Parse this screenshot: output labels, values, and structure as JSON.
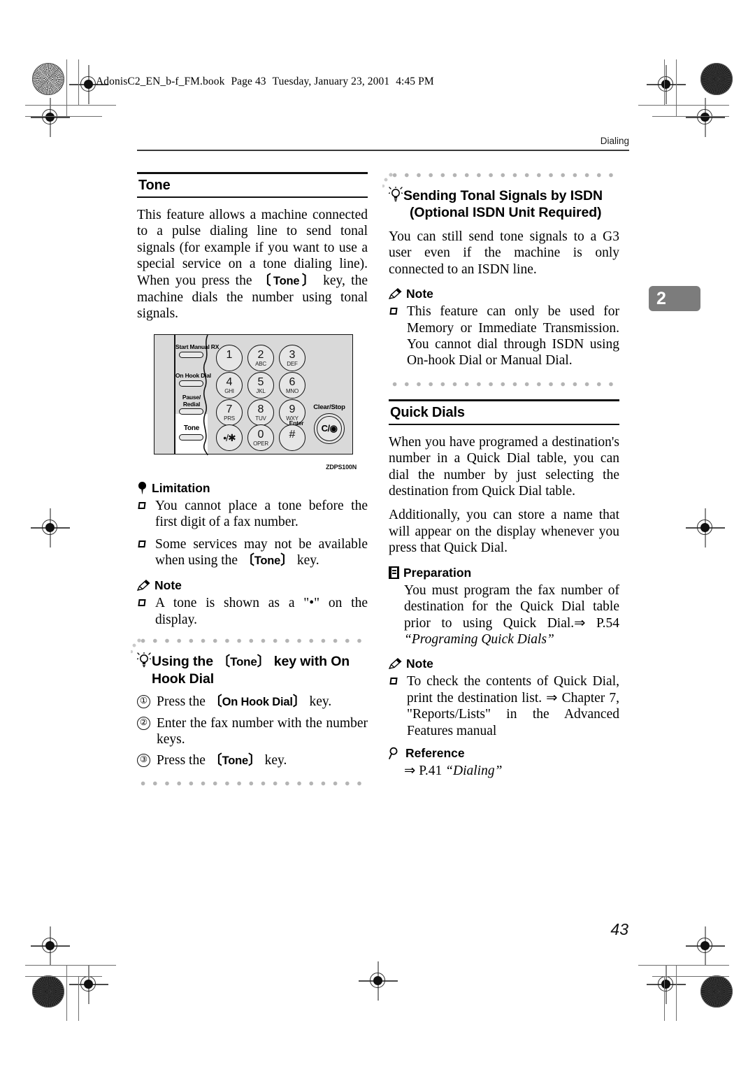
{
  "page": {
    "file_header": "AdonisC2_EN_b-f_FM.book  Page 43  Tuesday, January 23, 2001  4:45 PM",
    "file_header_parts": {
      "book": "AdonisC2_EN_b-f_FM.book",
      "page": "Page 43",
      "day": "Tuesday, January 23, 2001",
      "time": "4:45 PM"
    },
    "running_head": "Dialing",
    "chapter_tab": "2",
    "page_number": "43"
  },
  "left_column": {
    "section_title": "Tone",
    "intro_paragraph_pre": "This feature allows a machine connected to a pulse dialing line to send tonal signals (for example if you want to use a special service on a tone dialing line). When you press the ",
    "intro_keycap": "Tone",
    "intro_paragraph_post": " key, the machine dials the number using tonal signals.",
    "figure": {
      "id": "ZDPS100N",
      "side_buttons": [
        "Start Manual RX",
        "On Hook Dial",
        "Pause/",
        "Redial",
        "Tone"
      ],
      "highlighted_button": "Tone",
      "keys": [
        {
          "digit": "1",
          "letters": ""
        },
        {
          "digit": "2",
          "letters": "ABC"
        },
        {
          "digit": "3",
          "letters": "DEF"
        },
        {
          "digit": "4",
          "letters": "GHI"
        },
        {
          "digit": "5",
          "letters": "JKL"
        },
        {
          "digit": "6",
          "letters": "MNO"
        },
        {
          "digit": "7",
          "letters": "PRS"
        },
        {
          "digit": "8",
          "letters": "TUV"
        },
        {
          "digit": "9",
          "letters": "WXY"
        },
        {
          "digit": "•/✱",
          "letters": ""
        },
        {
          "digit": "0",
          "letters": "OPER"
        },
        {
          "digit": "#",
          "letters": ""
        }
      ],
      "enter_label": "Enter",
      "clear_stop_label": "Clear/Stop",
      "clear_stop_key": "C/"
    },
    "limitation": {
      "title": "Limitation",
      "items": [
        {
          "pre": "You cannot place a tone before the first digit of a fax number.",
          "keycap": "",
          "post": ""
        },
        {
          "pre": "Some services may not be available when using the ",
          "keycap": "Tone",
          "post": " key."
        }
      ]
    },
    "note": {
      "title": "Note",
      "items": [
        {
          "pre": "A tone is shown as a \"•\" on the display.",
          "keycap": "",
          "post": ""
        }
      ]
    },
    "tip": {
      "title_pre": "Using the ",
      "title_keycap": "Tone",
      "title_post": " key with On Hook Dial",
      "steps": [
        {
          "num": "①",
          "pre": "Press the ",
          "keycap": "On Hook Dial",
          "post": " key."
        },
        {
          "num": "②",
          "pre": "Enter the fax number with the number keys.",
          "keycap": "",
          "post": ""
        },
        {
          "num": "③",
          "pre": "Press the ",
          "keycap": "Tone",
          "post": " key."
        }
      ]
    }
  },
  "right_column": {
    "tip": {
      "title_line1": "Sending Tonal Signals by ISDN",
      "title_line2": "(Optional ISDN Unit Required)",
      "body": "You can still send tone signals to a G3 user even if the machine is only connected to an ISDN line.",
      "note_title": "Note",
      "note_items": [
        "This feature can only be used for Memory or Immediate Transmission. You cannot dial through ISDN using On-hook Dial or Manual Dial."
      ]
    },
    "section_title": "Quick Dials",
    "paragraphs": [
      "When you have programed a destination's number in a Quick Dial table, you can dial the number by just selecting the destination from Quick Dial table.",
      "Additionally, you can store a name that will appear on the display whenever you press that Quick Dial."
    ],
    "preparation": {
      "title": "Preparation",
      "body_pre": "You must program the fax number of destination for the Quick Dial table prior to using Quick Dial.",
      "arrow": "⇒",
      "ref_page": "P.54",
      "ref_title": "“Programing Quick Dials”"
    },
    "note": {
      "title": "Note",
      "items": [
        {
          "pre": "To check the contents of Quick Dial, print the destination list. ",
          "arrow": "⇒",
          "post": " Chapter 7, \"Reports/Lists\" in the Advanced Features manual"
        }
      ]
    },
    "reference": {
      "title": "Reference",
      "arrow": "⇒",
      "page": "P.41",
      "title_italic": "“Dialing”"
    }
  },
  "colors": {
    "chapter_tab_bg": "#7c7c7c",
    "keypad_bg": "#d9d9d9",
    "dot_rule": "#b4b4b4",
    "rule": "#111111"
  }
}
